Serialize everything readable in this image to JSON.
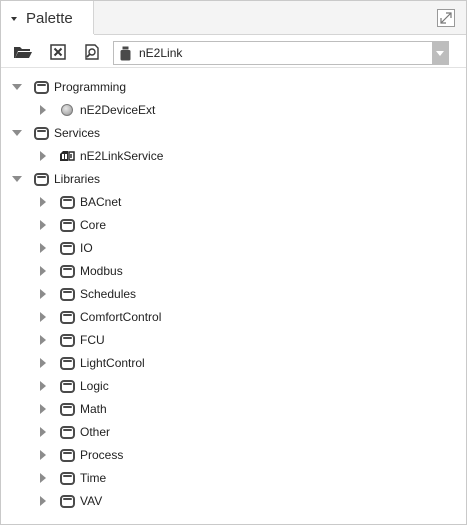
{
  "palette": {
    "title": "Palette"
  },
  "toolbar": {
    "module_value": "nE2Link"
  },
  "tree": [
    {
      "label": "Programming",
      "depth": 0,
      "expanded": true,
      "icon": "folder-icon"
    },
    {
      "label": "nE2DeviceExt",
      "depth": 1,
      "expanded": false,
      "icon": "device-ext-icon"
    },
    {
      "label": "Services",
      "depth": 0,
      "expanded": true,
      "icon": "folder-icon"
    },
    {
      "label": "nE2LinkService",
      "depth": 1,
      "expanded": false,
      "icon": "link-service-icon"
    },
    {
      "label": "Libraries",
      "depth": 0,
      "expanded": true,
      "icon": "folder-icon"
    },
    {
      "label": "BACnet",
      "depth": 1,
      "expanded": false,
      "icon": "folder-icon"
    },
    {
      "label": "Core",
      "depth": 1,
      "expanded": false,
      "icon": "folder-icon"
    },
    {
      "label": "IO",
      "depth": 1,
      "expanded": false,
      "icon": "folder-icon"
    },
    {
      "label": "Modbus",
      "depth": 1,
      "expanded": false,
      "icon": "folder-icon"
    },
    {
      "label": "Schedules",
      "depth": 1,
      "expanded": false,
      "icon": "folder-icon"
    },
    {
      "label": "ComfortControl",
      "depth": 1,
      "expanded": false,
      "icon": "folder-icon"
    },
    {
      "label": "FCU",
      "depth": 1,
      "expanded": false,
      "icon": "folder-icon"
    },
    {
      "label": "LightControl",
      "depth": 1,
      "expanded": false,
      "icon": "folder-icon"
    },
    {
      "label": "Logic",
      "depth": 1,
      "expanded": false,
      "icon": "folder-icon"
    },
    {
      "label": "Math",
      "depth": 1,
      "expanded": false,
      "icon": "folder-icon"
    },
    {
      "label": "Other",
      "depth": 1,
      "expanded": false,
      "icon": "folder-icon"
    },
    {
      "label": "Process",
      "depth": 1,
      "expanded": false,
      "icon": "folder-icon"
    },
    {
      "label": "Time",
      "depth": 1,
      "expanded": false,
      "icon": "folder-icon"
    },
    {
      "label": "VAV",
      "depth": 1,
      "expanded": false,
      "icon": "folder-icon"
    }
  ]
}
